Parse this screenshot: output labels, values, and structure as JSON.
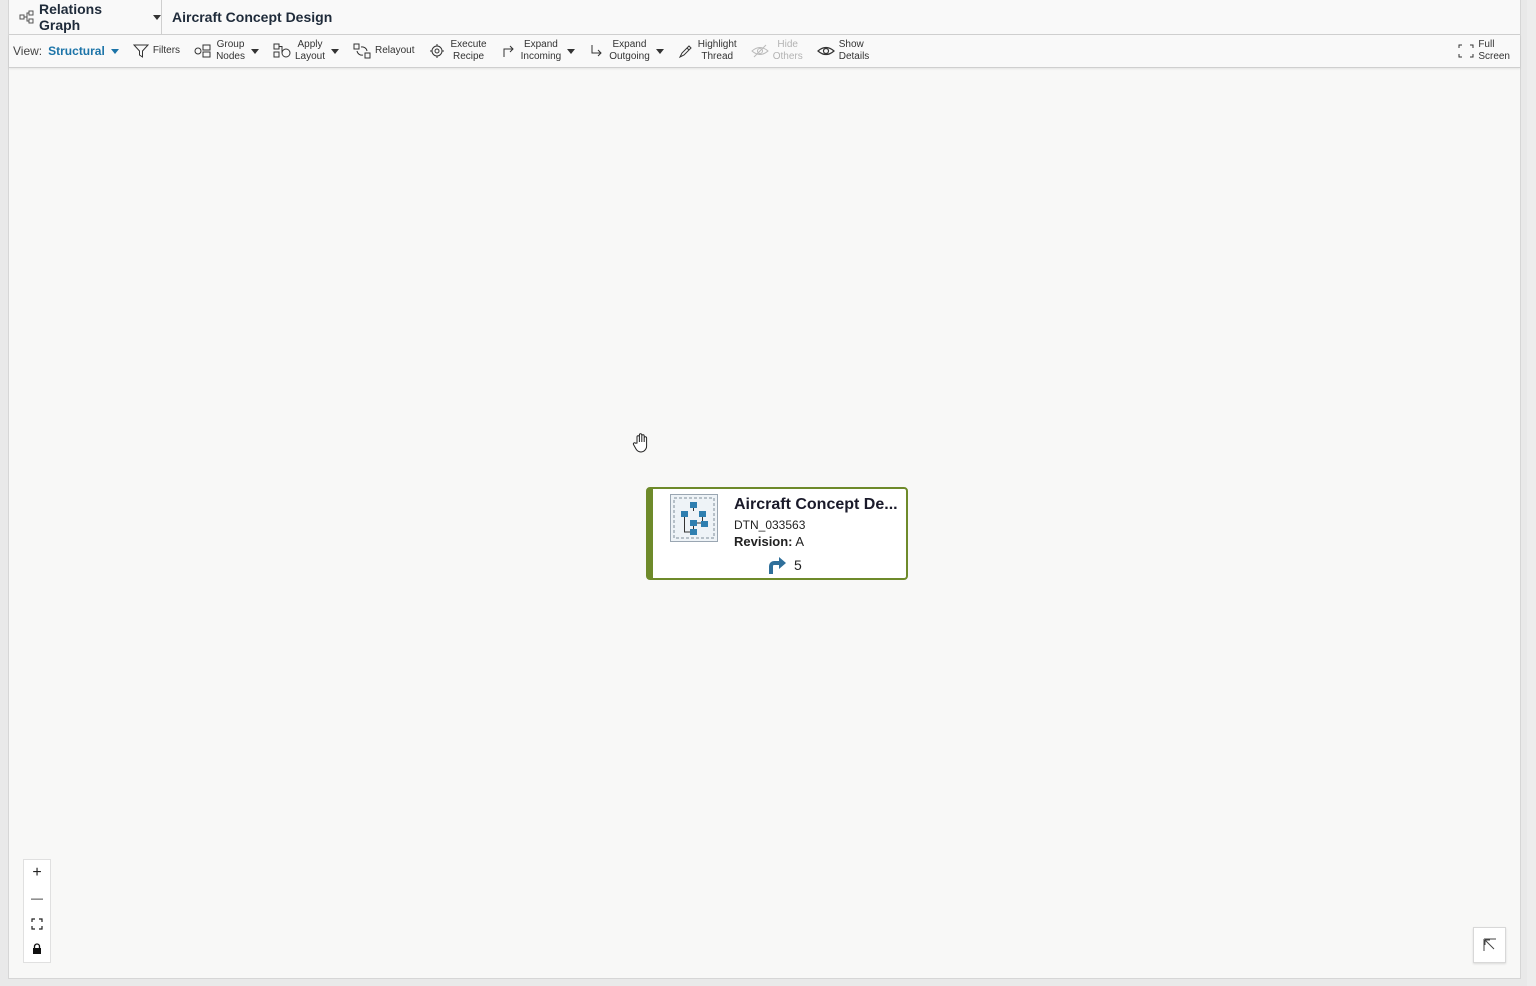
{
  "titlebar": {
    "app_name": "Relations Graph",
    "page_title": "Aircraft Concept Design"
  },
  "toolbar": {
    "view_label": "View:",
    "view_value": "Structural",
    "filters": "Filters",
    "group_nodes": [
      "Group",
      "Nodes"
    ],
    "apply_layout": [
      "Apply",
      "Layout"
    ],
    "relayout": "Relayout",
    "execute_recipe": [
      "Execute",
      "Recipe"
    ],
    "expand_incoming": [
      "Expand",
      "Incoming"
    ],
    "expand_outgoing": [
      "Expand",
      "Outgoing"
    ],
    "highlight_thread": [
      "Highlight",
      "Thread"
    ],
    "hide_others": [
      "Hide",
      "Others"
    ],
    "show_details": [
      "Show",
      "Details"
    ],
    "full_screen": [
      "Full",
      "Screen"
    ]
  },
  "node": {
    "title": "Aircraft Concept De...",
    "id": "DTN_033563",
    "revision_label": "Revision:",
    "revision_value": "A",
    "relation_count": "5"
  },
  "zoom": {
    "zoom_in": "+",
    "zoom_out": "—"
  },
  "colors": {
    "accent": "#1c74a8",
    "node_border": "#6e8a2a"
  }
}
